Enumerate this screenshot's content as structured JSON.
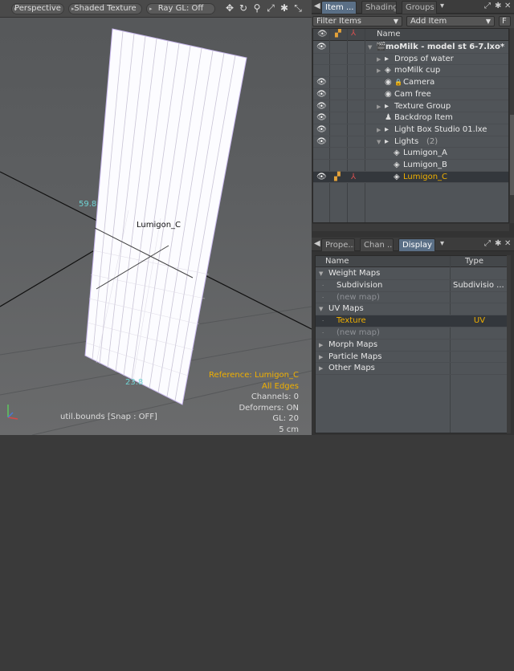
{
  "viewport": {
    "view_mode": "Perspective",
    "shading_mode": "Shaded Texture",
    "ray_gl": "Ray GL: Off",
    "icons": [
      "move-view-icon",
      "rotate-view-icon",
      "zoom-view-icon",
      "fit-view-icon",
      "settings-icon",
      "expand-icon"
    ],
    "measure_top": "59.8",
    "measure_bottom": "23.8",
    "object_label": "Lumigon_C",
    "info": {
      "reference": "Reference: Lumigon_C",
      "edges": "All Edges",
      "channels": "Channels: 0",
      "deformers": "Deformers: ON",
      "gl": "GL: 20",
      "scale": "5 cm"
    },
    "util": "util.bounds  [Snap : OFF]"
  },
  "item_panel": {
    "tabs": [
      "Item ...",
      "Shading",
      "Groups"
    ],
    "active_tab": 0,
    "filter_label": "Filter Items",
    "add_item_label": "Add Item",
    "f_label": "F",
    "column_name": "Name",
    "rows": [
      {
        "name": "moMilk - model st 6-7.lxo*",
        "indent": 0,
        "expand": "▼",
        "icon": "scene-icon",
        "glyph": "🎬",
        "eye": true,
        "bold": true
      },
      {
        "name": "Drops of water",
        "indent": 1,
        "expand": "▶",
        "icon": "mesh-group-icon",
        "glyph": "▸",
        "eye": false
      },
      {
        "name": "moMilk cup",
        "indent": 1,
        "expand": "▶",
        "icon": "mesh-icon",
        "glyph": "◈",
        "eye": false
      },
      {
        "name": "Camera",
        "indent": 1,
        "expand": "",
        "icon": "camera-icon",
        "glyph": "◉",
        "lock": true,
        "eye": true
      },
      {
        "name": "Cam free",
        "indent": 1,
        "expand": "",
        "icon": "camera-icon",
        "glyph": "◉",
        "eye": true
      },
      {
        "name": "Texture Group",
        "indent": 1,
        "expand": "▶",
        "icon": "group-icon",
        "glyph": "▸",
        "eye": true
      },
      {
        "name": "Backdrop Item",
        "indent": 1,
        "expand": "",
        "icon": "backdrop-icon",
        "glyph": "♟",
        "eye": true
      },
      {
        "name": "Light Box Studio 01.lxe",
        "indent": 1,
        "expand": "▶",
        "icon": "mesh-group-icon",
        "glyph": "▸",
        "eye": true
      },
      {
        "name": "Lights",
        "count": "(2)",
        "indent": 1,
        "expand": "▼",
        "icon": "group-icon",
        "glyph": "▸",
        "eye": true
      },
      {
        "name": "Lumigon_A",
        "indent": 2,
        "expand": "",
        "icon": "mesh-icon",
        "glyph": "◈",
        "eye": false
      },
      {
        "name": "Lumigon_B",
        "indent": 2,
        "expand": "",
        "icon": "mesh-icon",
        "glyph": "◈",
        "eye": false
      },
      {
        "name": "Lumigon_C",
        "indent": 2,
        "expand": "",
        "icon": "mesh-icon",
        "glyph": "◈",
        "eye": true,
        "selected": true
      }
    ]
  },
  "props_panel": {
    "tabs": [
      "Prope...",
      "Chan ...",
      "Display"
    ],
    "columns": {
      "name": "Name",
      "type": "Type"
    },
    "rows": [
      {
        "name": "Weight Maps",
        "type": "",
        "level": 0,
        "expand": "▼"
      },
      {
        "name": "Subdivision",
        "type": "Subdivisio ...",
        "level": 1
      },
      {
        "name": "(new map)",
        "type": "",
        "level": 1,
        "dim": true
      },
      {
        "name": "UV Maps",
        "type": "",
        "level": 0,
        "expand": "▼"
      },
      {
        "name": "Texture",
        "type": "UV",
        "level": 1,
        "selected": true
      },
      {
        "name": "(new map)",
        "type": "",
        "level": 1,
        "dim": true
      },
      {
        "name": "Morph Maps",
        "type": "",
        "level": 0,
        "expand": "▶"
      },
      {
        "name": "Particle Maps",
        "type": "",
        "level": 0,
        "expand": "▶"
      },
      {
        "name": "Other Maps",
        "type": "",
        "level": 0,
        "expand": "▶"
      }
    ]
  }
}
